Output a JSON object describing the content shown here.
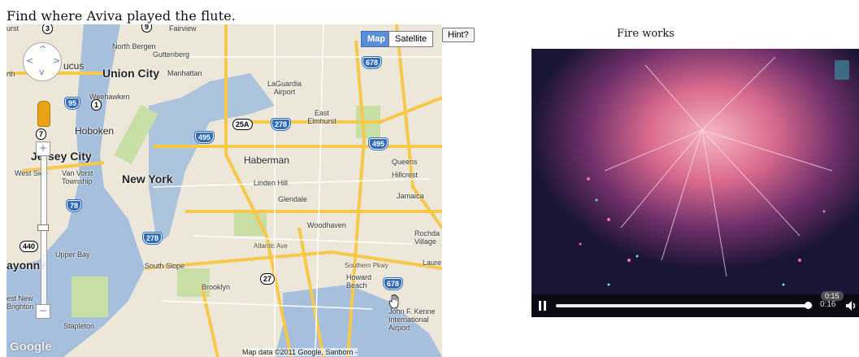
{
  "prompt": "Find where Aviva played the flute.",
  "map": {
    "map_button": "Map",
    "satellite_button": "Satellite",
    "hint_button": "Hint?",
    "pan_up": "^",
    "pan_left": "<",
    "pan_right": ">",
    "pan_down": "v",
    "zoom_in": "+",
    "zoom_out": "−",
    "footer": "Map data ©2011 Google, Sanborn -",
    "logo": "Google",
    "labels": {
      "fairview": "Fairview",
      "north_bergen": "North Bergen",
      "guttenberg": "Guttenberg",
      "union_city": "Union City",
      "manhattan": "Manhattan",
      "weehawken": "Weehawken",
      "laguardia": "LaGuardia Airport",
      "hoboken": "Hoboken",
      "east_elmhurst": "East Elmhurst",
      "jersey_city": "Jersey City",
      "haberman": "Haberman",
      "queens": "Queens",
      "west_side": "West Side",
      "van_vorst": "Van Vorst Township",
      "new_york": "New York",
      "linden_hill": "Linden Hill",
      "hillcrest": "Hillcrest",
      "glendale": "Glendale",
      "jamaica": "Jamaica",
      "woodhaven": "Woodhaven",
      "atlantic_ave": "Atlantic Ave",
      "rochdale": "Rochda Village",
      "upper_bay": "Upper Bay",
      "bayonne": "ayonne",
      "south_slope": "South Slope",
      "brooklyn": "Brooklyn",
      "southern_pkwy": "Southern Pkwy",
      "howard_beach": "Howard Beach",
      "west_new_brighton": "est New Brighton",
      "stapleton": "Stapleton",
      "jfk": "John F. Kenne International Airport",
      "lucus": "ucus",
      "urst": "urst",
      "rth": "rth",
      "laure": "Laure"
    },
    "shields": {
      "s3": "3",
      "s9": "9",
      "i678a": "678",
      "i95": "95",
      "us1": "1",
      "i495a": "495",
      "s25a": "25A",
      "i278a": "278",
      "i495b": "495",
      "s7": "7",
      "i78": "78",
      "s440": "440",
      "i278b": "278",
      "s27": "27",
      "i678b": "678"
    }
  },
  "video": {
    "title": "Fire works",
    "time": "0:16",
    "tooltip_time": "0:15",
    "progress": 0.98,
    "colors": {
      "bar": "#0c0a14",
      "fill": "#eeeeee"
    }
  }
}
